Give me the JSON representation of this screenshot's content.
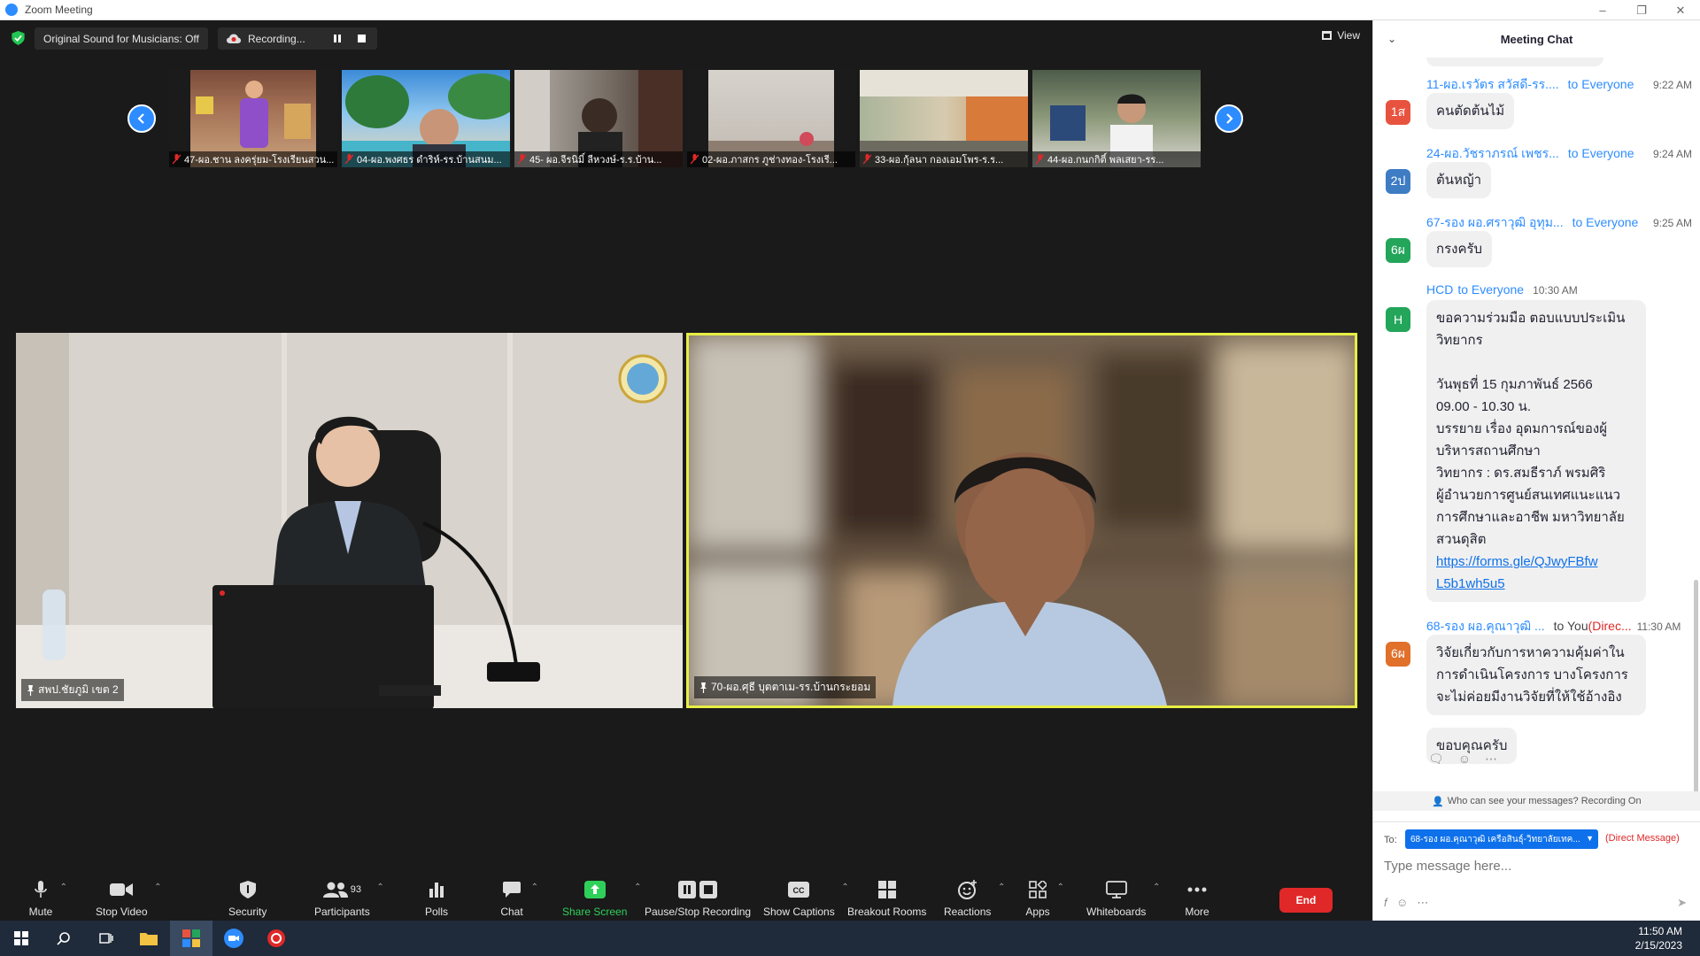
{
  "window": {
    "title": "Zoom Meeting"
  },
  "topbar": {
    "sound_label": "Original Sound for Musicians: Off",
    "recording_label": "Recording...",
    "view_label": "View"
  },
  "thumbnails": [
    {
      "label": "47-ผอ.ชาน ลงครุ่ยม-โรงเรียนสวน..."
    },
    {
      "label": "04-ผอ.พงศธร ดำริห์-รร.บ้านสนม..."
    },
    {
      "label": "45- ผอ.จีรนิมิ์ ลีหวงษ์-ร.ร.บ้าน..."
    },
    {
      "label": "02-ผอ.ภาสกร ภูช่างทอง-โรงเรี..."
    },
    {
      "label": "33-ผอ.กุ้ลนา กองเอมโพร-ร.ร..."
    },
    {
      "label": "44-ผอ.กนกกิติ์ พลเสยา-รร..."
    }
  ],
  "videos": {
    "left_label": "สพป.ชัยภูมิ เขต 2",
    "right_label": "70-ผอ.ศุธี บุตตาเม-รร.บ้านกระยอม"
  },
  "toolbar": {
    "mute": "Mute",
    "stop_video": "Stop Video",
    "security": "Security",
    "participants": "Participants",
    "participants_count": "93",
    "polls": "Polls",
    "chat": "Chat",
    "share_screen": "Share Screen",
    "pause_stop_recording": "Pause/Stop Recording",
    "show_captions": "Show Captions",
    "breakout_rooms": "Breakout Rooms",
    "reactions": "Reactions",
    "apps": "Apps",
    "whiteboards": "Whiteboards",
    "more": "More",
    "end": "End"
  },
  "chat": {
    "title": "Meeting Chat",
    "messages": [
      {
        "avatar": "1ส",
        "avatar_color": "#e8533f",
        "sender": "11-ผอ.เรวัตร สวัสดี-รร....",
        "to": "to Everyone",
        "time": "9:22 AM",
        "text": "คนตัดต้นไม้"
      },
      {
        "avatar": "2ป",
        "avatar_color": "#3e7cc4",
        "sender": "24-ผอ.วัชราภรณ์ เพชร...",
        "to": "to Everyone",
        "time": "9:24 AM",
        "text": "ต้นหญ้า"
      },
      {
        "avatar": "6ผ",
        "avatar_color": "#23a55a",
        "sender": "67-รอง ผอ.ศราวุฒิ อุทุม...",
        "to": "to Everyone",
        "time": "9:25 AM",
        "text": "กรงครับ"
      },
      {
        "avatar": "H",
        "avatar_color": "#23a55a",
        "sender": "HCD",
        "to": "to Everyone",
        "time": "10:30 AM",
        "lines": [
          "ขอความร่วมมือ ตอบแบบประเมิน",
          "วิทยากร",
          "",
          "วันพุธที่ 15 กุมภาพันธ์ 2566",
          "09.00 - 10.30 น.",
          "บรรยาย เรื่อง  อุดมการณ์ของผู้",
          "บริหารสถานศึกษา",
          "วิทยากร :   ดร.สมธีราภ์ พรมศิริ",
          "ผู้อำนวยการศูนย์สนเทศแนะแนว",
          "การศึกษาและอาชีพ มหาวิทยาลัย",
          "สวนดุสิต"
        ],
        "link_1": "https://forms.gle/QJwyFBfw",
        "link_2": "L5b1wh5u5"
      },
      {
        "avatar": "6ผ",
        "avatar_color": "#e0702a",
        "sender": "68-รอง ผอ.คุณาวุฒิ ...",
        "to": "to You",
        "direct": "(Direc...",
        "time": "11:30 AM",
        "lines": [
          "วิจัยเกี่ยวกับการหาความคุ้มค่าใน",
          "การดำเนินโครงการ บางโครงการ",
          "จะไม่ค่อยมีงานวิจัยที่ให้ใช้อ้างอิง"
        ],
        "text_2": "ขอบคุณครับ"
      }
    ],
    "who_can_see": "Who can see your messages? Recording On",
    "to_label": "To:",
    "to_value": "68-รอง ผอ.คุณาวุฒิ เครือสินธุ์-วิทยาลัยเทค...",
    "direct_message": "(Direct Message)",
    "input_placeholder": "Type message here..."
  },
  "taskbar": {
    "time": "11:50 AM",
    "date": "2/15/2023"
  },
  "colors": {
    "accent": "#2d8cff",
    "active_speaker": "#e7ee45",
    "end": "#e02828",
    "share": "#2fd05a"
  }
}
